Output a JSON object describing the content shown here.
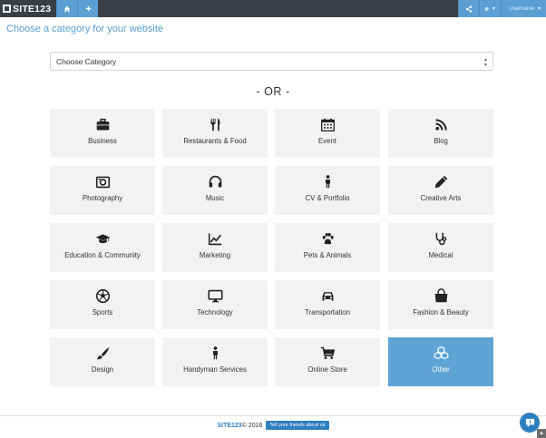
{
  "topbar": {
    "logo_text": "SITE123",
    "home_icon": "home-icon",
    "add_icon": "plus-icon",
    "share_icon": "share-icon",
    "globe_icon": "globe-icon",
    "user_icon": "user-icon",
    "user_name": "Username"
  },
  "header": {
    "title": "Choose a category for your website"
  },
  "category_select": {
    "value": "Choose Category"
  },
  "divider": {
    "text": "- OR -"
  },
  "categories": [
    {
      "label": "Business",
      "icon": "briefcase-icon"
    },
    {
      "label": "Restaurants & Food",
      "icon": "cutlery-icon"
    },
    {
      "label": "Event",
      "icon": "calendar-icon"
    },
    {
      "label": "Blog",
      "icon": "rss-icon"
    },
    {
      "label": "Photography",
      "icon": "camera-icon"
    },
    {
      "label": "Music",
      "icon": "headphones-icon"
    },
    {
      "label": "CV & Portfolio",
      "icon": "person-icon"
    },
    {
      "label": "Creative Arts",
      "icon": "pencil-icon"
    },
    {
      "label": "Education & Community",
      "icon": "graduation-cap-icon"
    },
    {
      "label": "Marketing",
      "icon": "line-chart-icon"
    },
    {
      "label": "Pets & Animals",
      "icon": "paw-icon"
    },
    {
      "label": "Medical",
      "icon": "stethoscope-icon"
    },
    {
      "label": "Sports",
      "icon": "soccer-ball-icon"
    },
    {
      "label": "Technology",
      "icon": "desktop-icon"
    },
    {
      "label": "Transportation",
      "icon": "car-icon"
    },
    {
      "label": "Fashion & Beauty",
      "icon": "shopping-bag-icon"
    },
    {
      "label": "Design",
      "icon": "paintbrush-icon"
    },
    {
      "label": "Handyman Services",
      "icon": "worker-icon"
    },
    {
      "label": "Online Store",
      "icon": "cart-icon"
    },
    {
      "label": "Other",
      "icon": "cubes-icon"
    }
  ],
  "selected_category": "Other",
  "footer": {
    "brand": "SITE123",
    "copyright": " © 2016",
    "share_button": "Tell your friends about us"
  },
  "colors": {
    "accent": "#5b9fd3",
    "active_tile": "#5ea4d4",
    "topbar": "#3a3f45",
    "tile": "#f2f2f2"
  }
}
